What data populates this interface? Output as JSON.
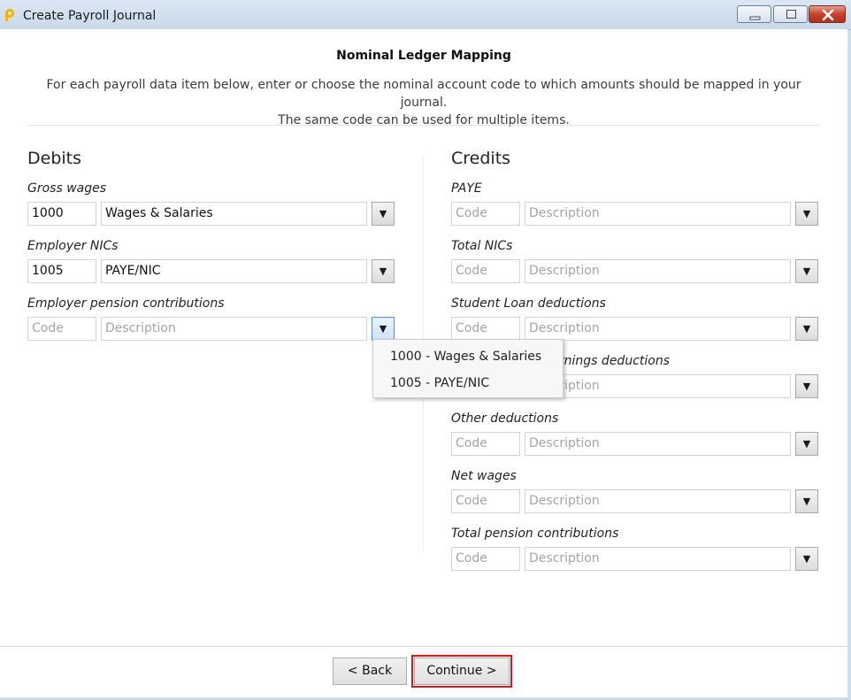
{
  "window": {
    "title": "Create Payroll Journal"
  },
  "page": {
    "heading": "Nominal Ledger Mapping",
    "subtitle_line1": "For each payroll data item below, enter or choose the nominal account code to which amounts should be mapped in your journal.",
    "subtitle_line2": "The same code can be used for multiple items."
  },
  "placeholders": {
    "code": "Code",
    "description": "Description"
  },
  "debits": {
    "title": "Debits",
    "items": [
      {
        "label": "Gross wages",
        "code": "1000",
        "description": "Wages & Salaries"
      },
      {
        "label": "Employer NICs",
        "code": "1005",
        "description": "PAYE/NIC"
      },
      {
        "label": "Employer pension contributions",
        "code": "",
        "description": ""
      }
    ]
  },
  "credits": {
    "title": "Credits",
    "items": [
      {
        "label": "PAYE",
        "code": "",
        "description": ""
      },
      {
        "label": "Total NICs",
        "code": "",
        "description": ""
      },
      {
        "label": "Student Loan deductions",
        "code": "",
        "description": ""
      },
      {
        "label": "Attachment of earnings deductions",
        "code": "",
        "description": ""
      },
      {
        "label": "Other deductions",
        "code": "",
        "description": ""
      },
      {
        "label": "Net wages",
        "code": "",
        "description": ""
      },
      {
        "label": "Total pension contributions",
        "code": "",
        "description": ""
      }
    ]
  },
  "dropdown": {
    "options": [
      "1000 - Wages & Salaries",
      "1005 - PAYE/NIC"
    ]
  },
  "footer": {
    "back_label": "< Back",
    "continue_label": "Continue >"
  },
  "icons": {
    "dropdown_arrow": "▼"
  }
}
